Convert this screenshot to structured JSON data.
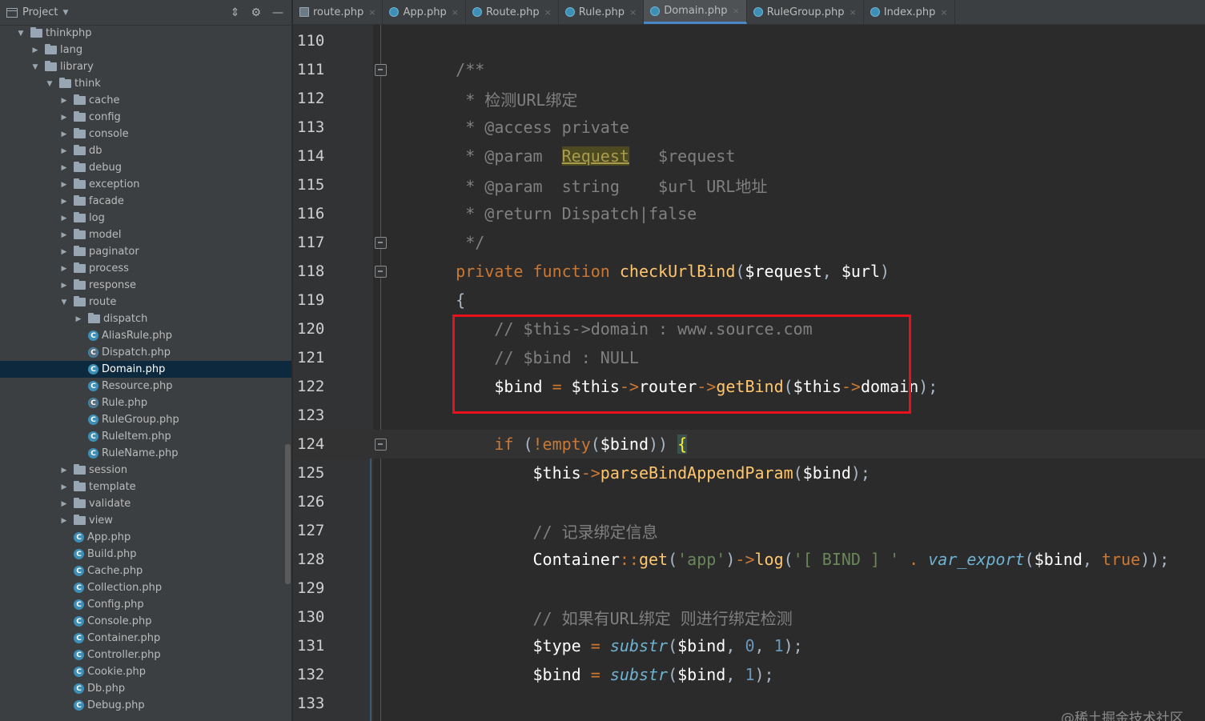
{
  "sidebar": {
    "title": "Project",
    "tree": [
      {
        "label": "thinkphp",
        "type": "folder",
        "depth": 0,
        "open": true
      },
      {
        "label": "lang",
        "type": "folder",
        "depth": 1,
        "open": false
      },
      {
        "label": "library",
        "type": "folder",
        "depth": 1,
        "open": true
      },
      {
        "label": "think",
        "type": "folder",
        "depth": 2,
        "open": true
      },
      {
        "label": "cache",
        "type": "folder",
        "depth": 3,
        "open": false
      },
      {
        "label": "config",
        "type": "folder",
        "depth": 3,
        "open": false
      },
      {
        "label": "console",
        "type": "folder",
        "depth": 3,
        "open": false
      },
      {
        "label": "db",
        "type": "folder",
        "depth": 3,
        "open": false
      },
      {
        "label": "debug",
        "type": "folder",
        "depth": 3,
        "open": false
      },
      {
        "label": "exception",
        "type": "folder",
        "depth": 3,
        "open": false
      },
      {
        "label": "facade",
        "type": "folder",
        "depth": 3,
        "open": false
      },
      {
        "label": "log",
        "type": "folder",
        "depth": 3,
        "open": false
      },
      {
        "label": "model",
        "type": "folder",
        "depth": 3,
        "open": false
      },
      {
        "label": "paginator",
        "type": "folder",
        "depth": 3,
        "open": false
      },
      {
        "label": "process",
        "type": "folder",
        "depth": 3,
        "open": false
      },
      {
        "label": "response",
        "type": "folder",
        "depth": 3,
        "open": false
      },
      {
        "label": "route",
        "type": "folder",
        "depth": 3,
        "open": true
      },
      {
        "label": "dispatch",
        "type": "folder",
        "depth": 4,
        "open": false
      },
      {
        "label": "AliasRule.php",
        "type": "class",
        "depth": 4
      },
      {
        "label": "Dispatch.php",
        "type": "abstract",
        "depth": 4
      },
      {
        "label": "Domain.php",
        "type": "class",
        "depth": 4,
        "selected": true
      },
      {
        "label": "Resource.php",
        "type": "class",
        "depth": 4
      },
      {
        "label": "Rule.php",
        "type": "abstract",
        "depth": 4
      },
      {
        "label": "RuleGroup.php",
        "type": "class",
        "depth": 4
      },
      {
        "label": "RuleItem.php",
        "type": "class",
        "depth": 4
      },
      {
        "label": "RuleName.php",
        "type": "class",
        "depth": 4
      },
      {
        "label": "session",
        "type": "folder",
        "depth": 3,
        "open": false
      },
      {
        "label": "template",
        "type": "folder",
        "depth": 3,
        "open": false
      },
      {
        "label": "validate",
        "type": "folder",
        "depth": 3,
        "open": false
      },
      {
        "label": "view",
        "type": "folder",
        "depth": 3,
        "open": false
      },
      {
        "label": "App.php",
        "type": "class",
        "depth": 3
      },
      {
        "label": "Build.php",
        "type": "class",
        "depth": 3
      },
      {
        "label": "Cache.php",
        "type": "class",
        "depth": 3
      },
      {
        "label": "Collection.php",
        "type": "class",
        "depth": 3
      },
      {
        "label": "Config.php",
        "type": "class",
        "depth": 3
      },
      {
        "label": "Console.php",
        "type": "class",
        "depth": 3
      },
      {
        "label": "Container.php",
        "type": "class",
        "depth": 3
      },
      {
        "label": "Controller.php",
        "type": "class",
        "depth": 3
      },
      {
        "label": "Cookie.php",
        "type": "class",
        "depth": 3
      },
      {
        "label": "Db.php",
        "type": "class",
        "depth": 3
      },
      {
        "label": "Debug.php",
        "type": "class",
        "depth": 3
      }
    ]
  },
  "tabs": [
    {
      "label": "route.php",
      "icon": "php"
    },
    {
      "label": "App.php",
      "icon": "class"
    },
    {
      "label": "Route.php",
      "icon": "class"
    },
    {
      "label": "Rule.php",
      "icon": "abstract"
    },
    {
      "label": "Domain.php",
      "icon": "class",
      "active": true
    },
    {
      "label": "RuleGroup.php",
      "icon": "class"
    },
    {
      "label": "Index.php",
      "icon": "class"
    }
  ],
  "editor": {
    "lines": [
      {
        "n": "110",
        "segs": []
      },
      {
        "n": "111",
        "fold": true,
        "segs": [
          [
            "c-cm",
            "    /**"
          ]
        ]
      },
      {
        "n": "112",
        "segs": [
          [
            "c-cm",
            "     * 检测URL绑定"
          ]
        ]
      },
      {
        "n": "113",
        "segs": [
          [
            "c-cm",
            "     * @access private"
          ]
        ]
      },
      {
        "n": "114",
        "segs": [
          [
            "c-cm",
            "     * @param  "
          ],
          [
            "c-hl",
            "Request"
          ],
          [
            "c-cm",
            "   $request"
          ]
        ]
      },
      {
        "n": "115",
        "segs": [
          [
            "c-cm",
            "     * @param  string    $url URL地址"
          ]
        ]
      },
      {
        "n": "116",
        "segs": [
          [
            "c-cm",
            "     * @return Dispatch|false"
          ]
        ]
      },
      {
        "n": "117",
        "fold": true,
        "segs": [
          [
            "c-cm",
            "     */"
          ]
        ]
      },
      {
        "n": "118",
        "fold": true,
        "segs": [
          [
            "c-kw",
            "    private function "
          ],
          [
            "c-fn",
            "checkUrlBind"
          ],
          [
            "",
            "("
          ],
          [
            "c-var",
            "$request"
          ],
          [
            "",
            ", "
          ],
          [
            "c-var",
            "$url"
          ],
          [
            "",
            ")"
          ]
        ]
      },
      {
        "n": "119",
        "segs": [
          [
            "",
            "    {"
          ]
        ]
      },
      {
        "n": "120",
        "segs": [
          [
            "c-cm",
            "        // $this->domain : www.source.com"
          ]
        ]
      },
      {
        "n": "121",
        "segs": [
          [
            "c-cm",
            "        // $bind : NULL"
          ]
        ]
      },
      {
        "n": "122",
        "segs": [
          [
            "c-var",
            "        $bind"
          ],
          [
            "c-op",
            " = "
          ],
          [
            "c-var",
            "$this"
          ],
          [
            "c-op",
            "->"
          ],
          [
            "c-var",
            "router"
          ],
          [
            "c-op",
            "->"
          ],
          [
            "c-fn",
            "getBind"
          ],
          [
            "",
            "("
          ],
          [
            "c-var",
            "$this"
          ],
          [
            "c-op",
            "->"
          ],
          [
            "c-var",
            "domain"
          ],
          [
            "",
            ");"
          ]
        ]
      },
      {
        "n": "123",
        "segs": []
      },
      {
        "n": "124",
        "fold": true,
        "cur": true,
        "segs": [
          [
            "c-kw",
            "        if "
          ],
          [
            "",
            "("
          ],
          [
            "c-kw",
            "!empty"
          ],
          [
            "",
            "("
          ],
          [
            "c-var",
            "$bind"
          ],
          [
            "",
            ")) "
          ],
          [
            "c-brace",
            "{"
          ]
        ]
      },
      {
        "n": "125",
        "segs": [
          [
            "c-var",
            "            $this"
          ],
          [
            "c-op",
            "->"
          ],
          [
            "c-fn",
            "parseBindAppendParam"
          ],
          [
            "",
            "("
          ],
          [
            "c-var",
            "$bind"
          ],
          [
            "",
            ");"
          ]
        ]
      },
      {
        "n": "126",
        "segs": []
      },
      {
        "n": "127",
        "segs": [
          [
            "c-cm",
            "            // 记录绑定信息"
          ]
        ]
      },
      {
        "n": "128",
        "segs": [
          [
            "c-var",
            "            Container"
          ],
          [
            "c-op",
            "::"
          ],
          [
            "c-fn",
            "get"
          ],
          [
            "",
            "("
          ],
          [
            "c-str",
            "'app'"
          ],
          [
            "",
            ")"
          ],
          [
            "c-op",
            "->"
          ],
          [
            "c-fn",
            "log"
          ],
          [
            "",
            "("
          ],
          [
            "c-str",
            "'[ BIND ] '"
          ],
          [
            "c-op",
            " . "
          ],
          [
            "c-itf",
            "var_export"
          ],
          [
            "",
            "("
          ],
          [
            "c-var",
            "$bind"
          ],
          [
            "",
            ", "
          ],
          [
            "c-kw",
            "true"
          ],
          [
            "",
            "));"
          ]
        ]
      },
      {
        "n": "129",
        "segs": []
      },
      {
        "n": "130",
        "segs": [
          [
            "c-cm",
            "            // 如果有URL绑定 则进行绑定检测"
          ]
        ]
      },
      {
        "n": "131",
        "segs": [
          [
            "c-var",
            "            $type"
          ],
          [
            "c-op",
            " = "
          ],
          [
            "c-itf",
            "substr"
          ],
          [
            "",
            "("
          ],
          [
            "c-var",
            "$bind"
          ],
          [
            "",
            ", "
          ],
          [
            "c-num",
            "0"
          ],
          [
            "",
            ", "
          ],
          [
            "c-num",
            "1"
          ],
          [
            "",
            ");"
          ]
        ]
      },
      {
        "n": "132",
        "segs": [
          [
            "c-var",
            "            $bind"
          ],
          [
            "c-op",
            " = "
          ],
          [
            "c-itf",
            "substr"
          ],
          [
            "",
            "("
          ],
          [
            "c-var",
            "$bind"
          ],
          [
            "",
            ", "
          ],
          [
            "c-num",
            "1"
          ],
          [
            "",
            ");"
          ]
        ]
      },
      {
        "n": "133",
        "segs": []
      }
    ]
  },
  "watermark": "@稀土掘金技术社区"
}
